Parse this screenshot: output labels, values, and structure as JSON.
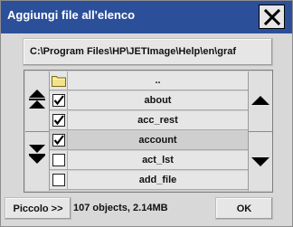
{
  "window": {
    "title": "Aggiungi file all'elenco",
    "close_icon": "close-x-icon"
  },
  "path": {
    "value": "C:\\Program Files\\HP\\JETImage\\Help\\en\\graf"
  },
  "list": {
    "rows": [
      {
        "name": "..",
        "icon": "folder-icon",
        "checked": null,
        "selected": false
      },
      {
        "name": "about",
        "icon": "checkbox",
        "checked": true,
        "selected": false
      },
      {
        "name": "acc_rest",
        "icon": "checkbox",
        "checked": true,
        "selected": false
      },
      {
        "name": "account",
        "icon": "checkbox",
        "checked": true,
        "selected": true
      },
      {
        "name": "act_lst",
        "icon": "checkbox",
        "checked": false,
        "selected": false
      },
      {
        "name": "add_file",
        "icon": "checkbox",
        "checked": false,
        "selected": false
      }
    ],
    "left_nav_icons": [
      "page-up-icon",
      "page-down-icon"
    ],
    "right_nav_icons": [
      "scroll-up-icon",
      "scroll-down-icon"
    ]
  },
  "footer": {
    "piccolo_label": "Piccolo >>",
    "status": "107 objects, 2.14MB",
    "ok_label": "OK"
  },
  "colors": {
    "titlebar": "#2c4f9a",
    "dialog_bg": "#d8d8d8",
    "row_bg": "#e6e6e6",
    "selected_row_bg": "#cfcfcf"
  }
}
